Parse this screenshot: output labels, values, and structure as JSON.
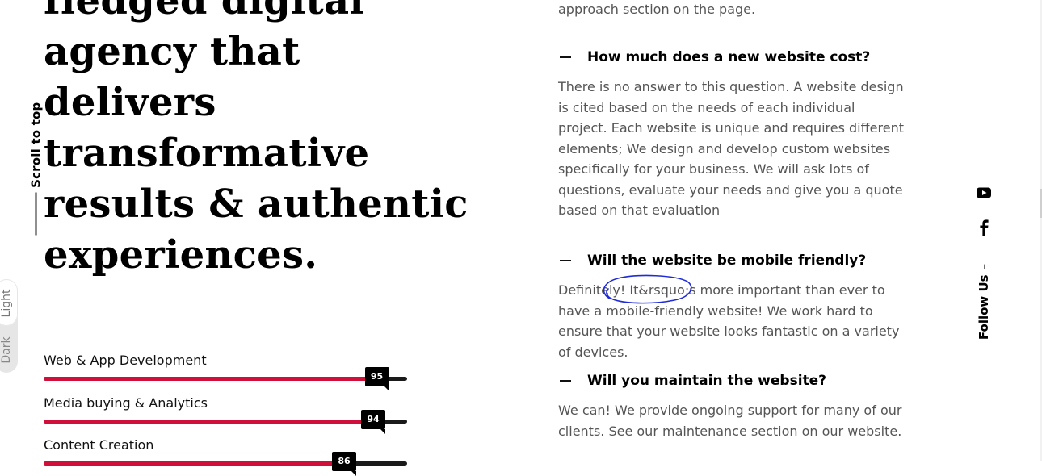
{
  "sidebar": {
    "scroll_to_top": "Scroll to top",
    "mode_light": "Light",
    "mode_dark": "Dark"
  },
  "headline": {
    "lines": [
      "fledged digital",
      "agency that",
      "delivers",
      "transformative",
      "results & authentic",
      "experiences."
    ]
  },
  "skills": [
    {
      "label": "Web & App Development",
      "value": "95",
      "percent": 95
    },
    {
      "label": "Media buying & Analytics",
      "value": "94",
      "percent": 94
    },
    {
      "label": "Content Creation",
      "value": "86",
      "percent": 86
    }
  ],
  "faq": {
    "intro_tail": "approach section on the page.",
    "items": [
      {
        "question": "How much does a new website cost?",
        "answer": "There is no answer to this question. A website design is cited based on the needs of each individual project. Each website is unique and requires different elements; We design and develop custom websites specifically for your business. We will ask lots of questions, evaluate your needs and give you a quote based on that evaluation"
      },
      {
        "question": "Will the website be mobile friendly?",
        "answer": "Definitely! It&rsquo;s more important than ever to have a mobile-friendly website! We work hard to ensure that your website looks fantastic on a variety of devices."
      },
      {
        "question": "Will you maintain the website?",
        "answer": "We can! We provide ongoing support for many of our clients. See our maintenance section on our website."
      }
    ]
  },
  "social": {
    "follow_label": "Follow Us",
    "separator": "–",
    "icons": [
      "youtube-icon",
      "facebook-icon"
    ]
  },
  "colors": {
    "accent": "#d0103a",
    "track": "#1a1a1a",
    "annotation": "#1f2bd6"
  }
}
